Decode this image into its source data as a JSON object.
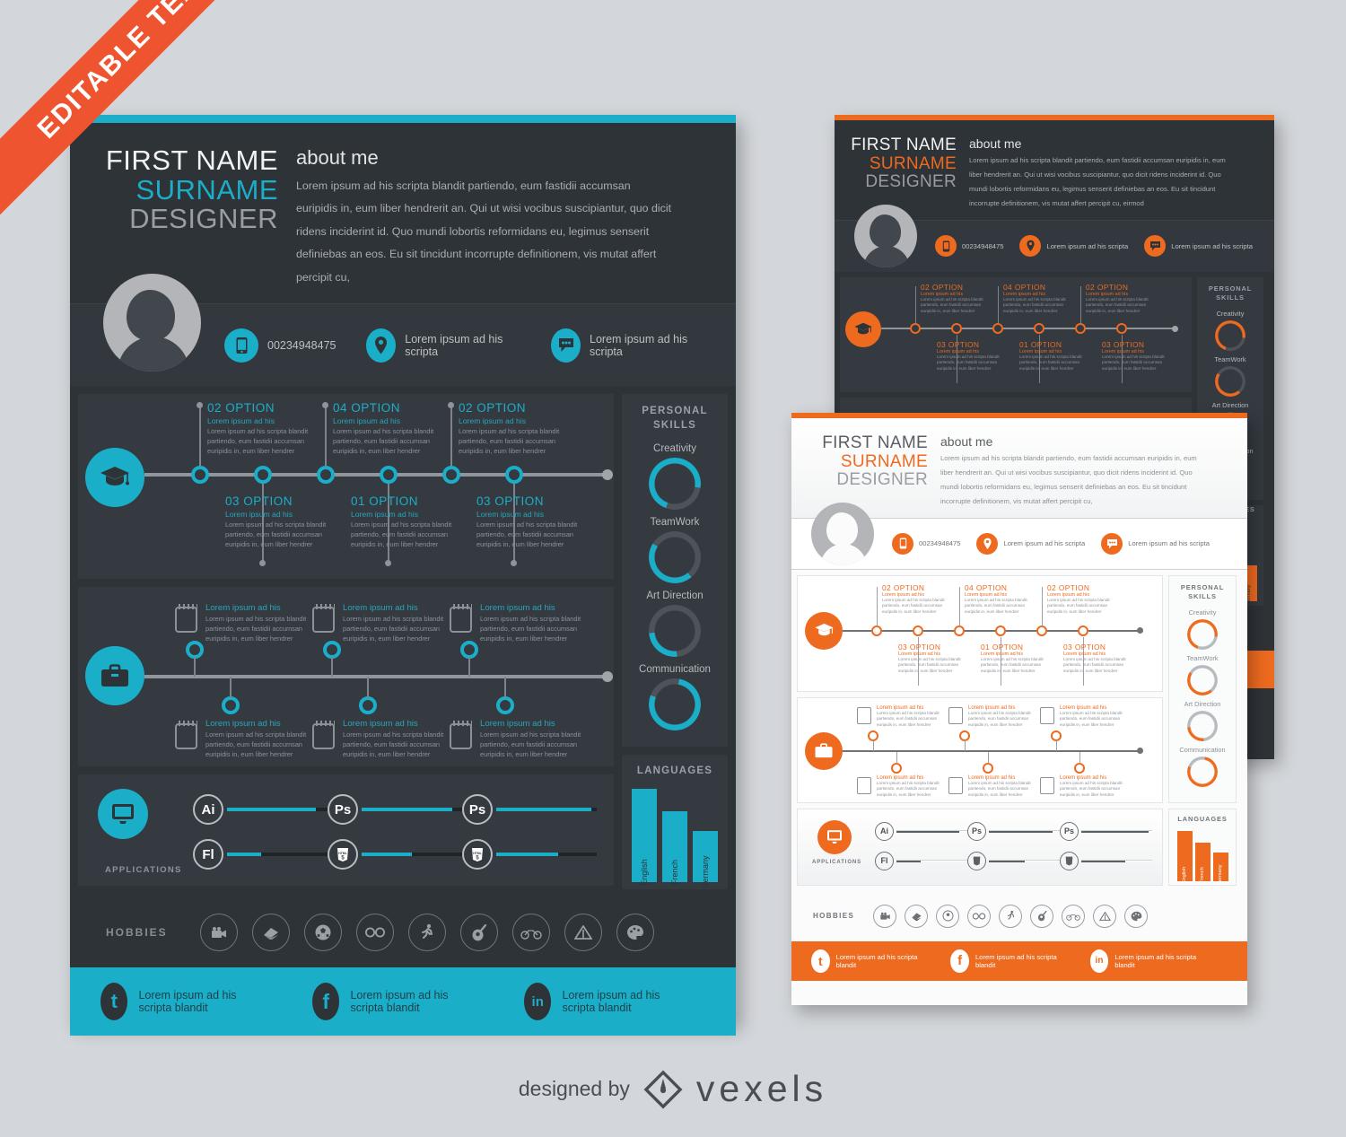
{
  "ribbon": {
    "label": "EDITABLE TEXT"
  },
  "colors": {
    "cyan": "#1aaec9",
    "orange": "#ee6a1f",
    "ribbon_orange": "#ee5430",
    "dark": "#2e3338",
    "panel": "#343a40",
    "white": "#fbfbfb",
    "grey_text": "#9a9da1"
  },
  "resume": {
    "name_first": "FIRST NAME",
    "name_last": "SURNAME",
    "role": "DESIGNER",
    "about_title": "about me",
    "about_text": "Lorem ipsum ad his scripta blandit partiendo, eum fastidii accumsan euripidis in, eum liber hendrerit an. Qui ut wisi vocibus suscipiantur, quo dicit ridens inciderint id. Quo mundi lobortis reformidans eu, legimus senserit definiebas an eos. Eu sit tincidunt incorrupte definitionem, vis mutat affert percipit cu,",
    "about_text_wide": "Lorem ipsum ad his scripta blandit partiendo, eum fastidii accumsan euripidis in, eum liber hendrerit an. Qui ut wisi vocibus suscipiantur, quo dicit ridens inciderint id. Quo mundi lobortis reformidans eu, legimus senserit definiebas an eos. Eu sit tincidunt incorrupte definitionem, vis mutat affert percipit cu, eirmod",
    "contacts": [
      {
        "icon": "phone-icon",
        "text": "00234948475"
      },
      {
        "icon": "location-pin-icon",
        "text": "Lorem ipsum ad his scripta"
      },
      {
        "icon": "chat-bubble-icon",
        "text": "Lorem ipsum ad his scripta"
      }
    ],
    "education": {
      "icon": "graduation-cap-icon",
      "items_top": [
        {
          "heading": "02 OPTION",
          "subtitle": "Lorem ipsum ad his",
          "body": "Lorem ipsum ad his scripta blandit partiendo, eum fastidii accumsan euripidis in, eum liber hendrer"
        },
        {
          "heading": "04 OPTION",
          "subtitle": "Lorem ipsum ad his",
          "body": "Lorem ipsum ad his scripta blandit partiendo, eum fastidii accumsan euripidis in, eum liber hendrer"
        },
        {
          "heading": "02 OPTION",
          "subtitle": "Lorem ipsum ad his",
          "body": "Lorem ipsum ad his scripta blandit partiendo, eum fastidii accumsan euripidis in, eum liber hendrer"
        }
      ],
      "items_bottom": [
        {
          "heading": "03 OPTION",
          "subtitle": "Lorem ipsum ad his",
          "body": "Lorem ipsum ad his scripta blandit partiendo, eum fastidii accumsan euripidis in, eum liber hendrer"
        },
        {
          "heading": "01 OPTION",
          "subtitle": "Lorem ipsum ad his",
          "body": "Lorem ipsum ad his scripta blandit partiendo, eum fastidii accumsan euripidis in, eum liber hendrer"
        },
        {
          "heading": "03 OPTION",
          "subtitle": "Lorem ipsum ad his",
          "body": "Lorem ipsum ad his scripta blandit partiendo, eum fastidii accumsan euripidis in, eum liber hendrer"
        }
      ]
    },
    "work": {
      "icon": "briefcase-icon",
      "items_top": [
        {
          "subtitle": "Lorem ipsum ad his",
          "body": "Lorem ipsum ad his scripta blandit partiendo, eum fastidii accumsan euripidis in, eum liber hendrer"
        },
        {
          "subtitle": "Lorem ipsum ad his",
          "body": "Lorem ipsum ad his scripta blandit partiendo, eum fastidii accumsan euripidis in, eum liber hendrer"
        },
        {
          "subtitle": "Lorem ipsum ad his",
          "body": "Lorem ipsum ad his scripta blandit partiendo, eum fastidii accumsan euripidis in, eum liber hendrer"
        }
      ],
      "items_bottom": [
        {
          "subtitle": "Lorem ipsum ad his",
          "body": "Lorem ipsum ad his scripta blandit partiendo, eum fastidii accumsan euripidis in, eum liber hendrer"
        },
        {
          "subtitle": "Lorem ipsum ad his",
          "body": "Lorem ipsum ad his scripta blandit partiendo, eum fastidii accumsan euripidis in, eum liber hendrer"
        },
        {
          "subtitle": "Lorem ipsum ad his",
          "body": "Lorem ipsum ad his scripta blandit partiendo, eum fastidii accumsan euripidis in, eum liber hendrer"
        }
      ]
    },
    "applications": {
      "icon": "monitor-icon",
      "label": "APPLICATIONS",
      "items": [
        {
          "badge": "Ai",
          "percent": 88
        },
        {
          "badge": "Ps",
          "percent": 90
        },
        {
          "badge": "Ps",
          "percent": 95
        },
        {
          "badge": "Fl",
          "percent": 34
        },
        {
          "badge": "H5",
          "percent": 50
        },
        {
          "badge": "H5",
          "percent": 62
        }
      ]
    },
    "personal_skills": {
      "title_line1": "PERSONAL",
      "title_line2": "SKILLS",
      "items": [
        {
          "label": "Creativity",
          "percent": 72
        },
        {
          "label": "TeamWork",
          "percent": 45
        },
        {
          "label": "Art Direction",
          "percent": 25
        },
        {
          "label": "Communication",
          "percent": 78
        }
      ]
    },
    "hobbies": {
      "label": "HOBBIES",
      "icons": [
        "video-camera-icon",
        "book-icon",
        "soccer-ball-icon",
        "glasses-icon",
        "running-icon",
        "guitar-icon",
        "bicycle-icon",
        "tent-icon",
        "palette-icon"
      ]
    },
    "social": [
      {
        "icon": "twitter-icon",
        "text": "Lorem ipsum ad his scripta blandit"
      },
      {
        "icon": "facebook-icon",
        "text": "Lorem ipsum ad his scripta blandit"
      },
      {
        "icon": "linkedin-icon",
        "text": "Lorem ipsum ad his scripta blandit"
      }
    ]
  },
  "chart_data": {
    "type": "bar",
    "title": "LANGUAGES",
    "categories": [
      "English",
      "French",
      "Germany"
    ],
    "values": [
      100,
      76,
      55
    ],
    "xlabel": "",
    "ylabel": "",
    "ylim": [
      0,
      100
    ],
    "grid": false,
    "legend": "none"
  },
  "footer": {
    "designed_by": "designed by",
    "brand": "vexels",
    "logo": "vexels-diamond-pen-icon"
  }
}
